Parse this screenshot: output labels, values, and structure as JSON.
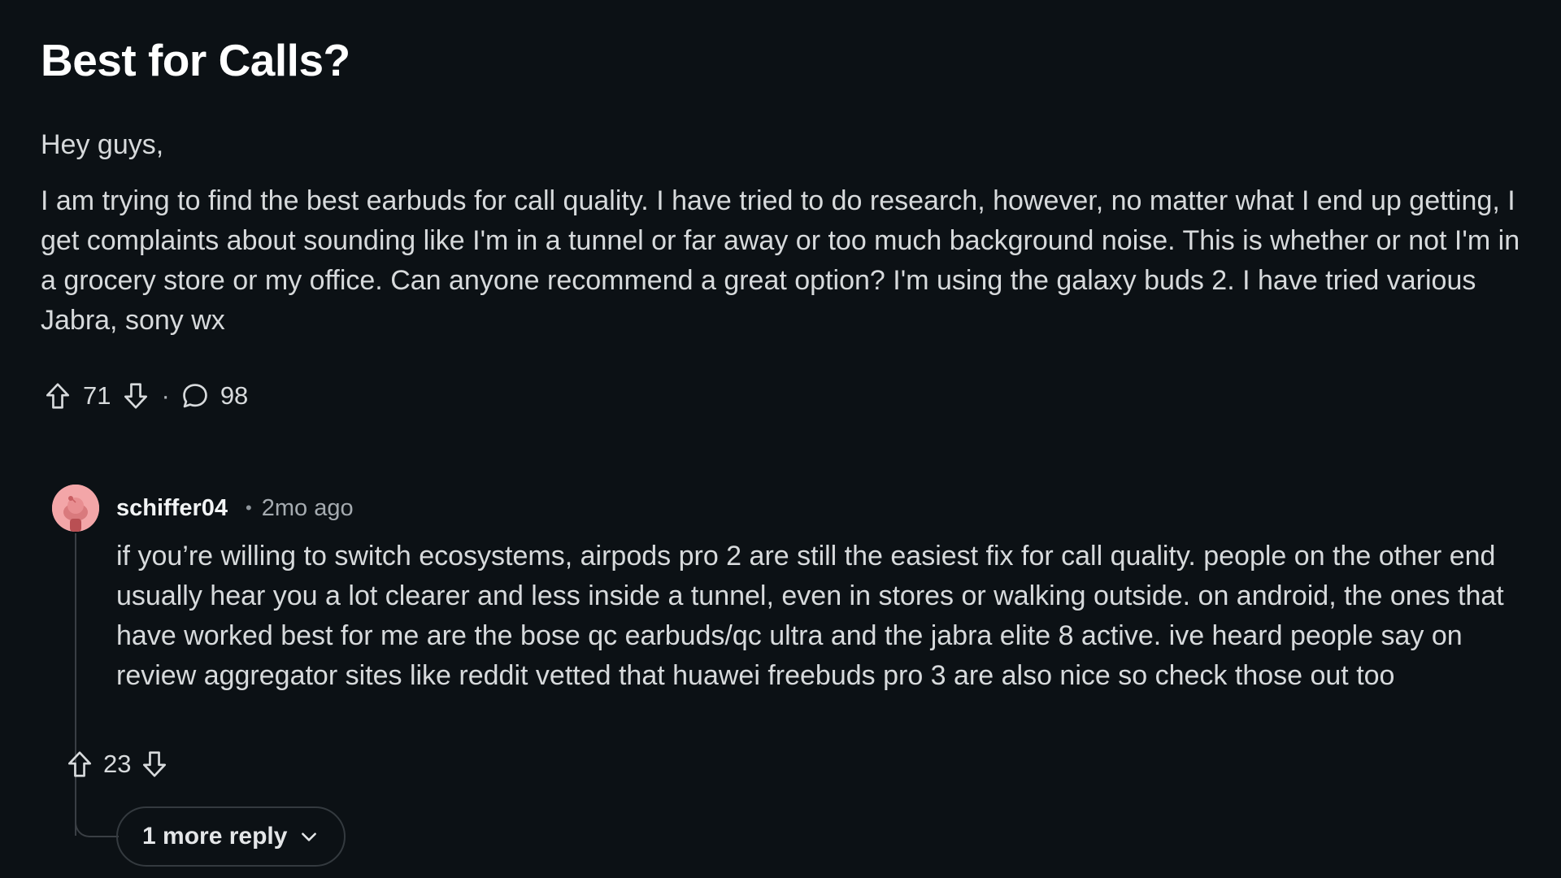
{
  "post": {
    "title": "Best for Calls?",
    "body": [
      "Hey guys,",
      "I am trying to find the best earbuds for call quality. I have tried to do research, however, no matter what I end up getting, I get complaints about sounding like I'm in a tunnel or far away or too much background noise. This is whether or not I'm in a grocery store or my office. Can anyone recommend a great option? I'm using the galaxy buds 2. I have tried various Jabra, sony wx"
    ],
    "upvotes": "71",
    "separator": "·",
    "comments": "98",
    "icons": {
      "upvote": "arrow-up-icon",
      "downvote": "arrow-down-icon",
      "comments": "comment-bubble-icon"
    }
  },
  "comment": {
    "author": "schiffer04",
    "separator": "•",
    "time": "2mo ago",
    "body": "if you’re willing to switch ecosystems, airpods pro 2 are still the easiest fix for call quality. people on the other end usually hear you a lot clearer and less inside a tunnel, even in stores or walking outside. on android, the ones that have worked best for me are the bose qc earbuds/qc ultra and the jabra elite 8 active. ive heard people say on review aggregator sites like reddit vetted that huawei freebuds pro 3 are also nice so check those out too",
    "upvotes": "23",
    "more_replies_label": "1 more reply",
    "avatar_color": "#f3a6a8"
  },
  "colors": {
    "background": "#0c1115",
    "text": "#d7dadc",
    "title": "#ffffff",
    "muted": "#a5abb0"
  }
}
